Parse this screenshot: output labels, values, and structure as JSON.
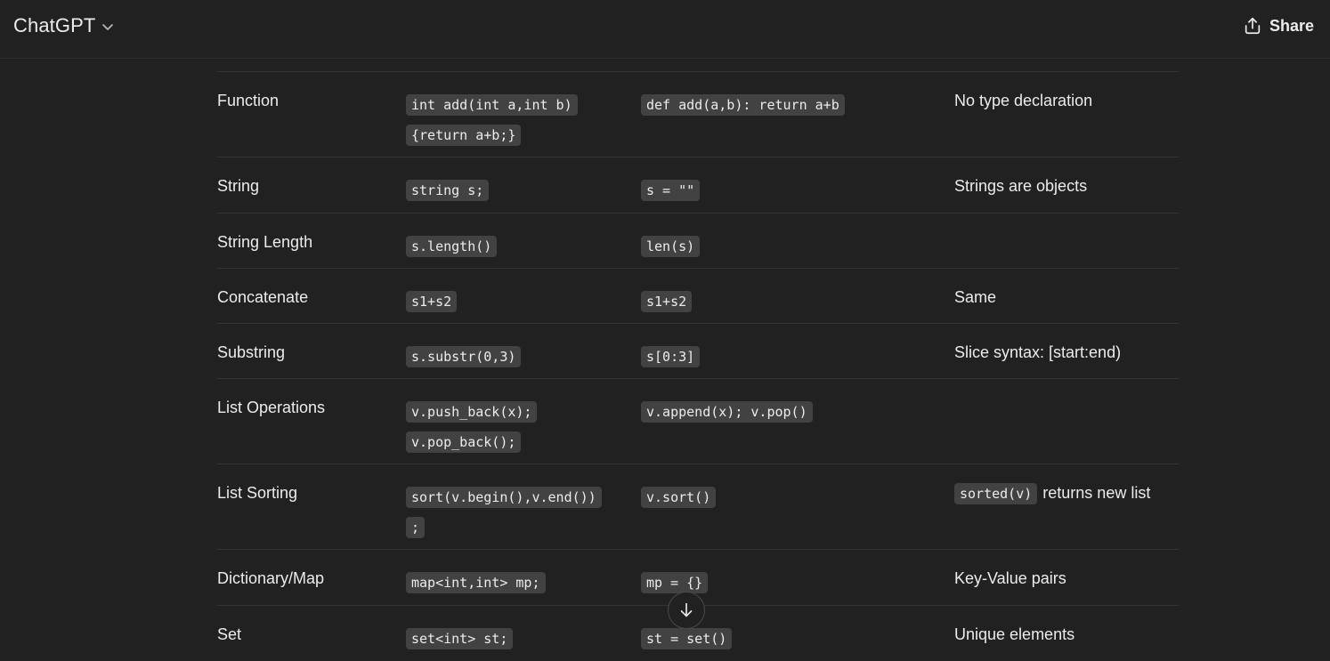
{
  "header": {
    "title": "ChatGPT",
    "share_label": "Share"
  },
  "rows": [
    {
      "feature": "Function",
      "cpp": "int add(int a,int b)",
      "cpp2": "{return a+b;}",
      "python": "def add(a,b): return a+b",
      "note": "No type declaration",
      "note_code": ""
    },
    {
      "feature": "String",
      "cpp": "string s;",
      "cpp2": "",
      "python": "s = \"\"",
      "note": "Strings are objects",
      "note_code": ""
    },
    {
      "feature": "String Length",
      "cpp": "s.length()",
      "cpp2": "",
      "python": "len(s)",
      "note": "",
      "note_code": ""
    },
    {
      "feature": "Concatenate",
      "cpp": "s1+s2",
      "cpp2": "",
      "python": "s1+s2",
      "note": "Same",
      "note_code": ""
    },
    {
      "feature": "Substring",
      "cpp": "s.substr(0,3)",
      "cpp2": "",
      "python": "s[0:3]",
      "note": "Slice syntax: [start:end)",
      "note_code": ""
    },
    {
      "feature": "List Operations",
      "cpp": "v.push_back(x);",
      "cpp2": "v.pop_back();",
      "python": "v.append(x); v.pop()",
      "note": "",
      "note_code": ""
    },
    {
      "feature": "List Sorting",
      "cpp": "sort(v.begin(),v.end())",
      "cpp2": ";",
      "python": "v.sort()",
      "note": "returns new list",
      "note_code": "sorted(v)"
    },
    {
      "feature": "Dictionary/Map",
      "cpp": "map<int,int> mp;",
      "cpp2": "",
      "python": "mp = {}",
      "note": "Key-Value pairs",
      "note_code": ""
    },
    {
      "feature": "Set",
      "cpp": "set<int> st;",
      "cpp2": "",
      "python": "st = set()",
      "note": "Unique elements",
      "note_code": ""
    }
  ],
  "icons": {
    "chevron": "chevron-down-icon",
    "share": "share-icon",
    "scroll": "arrow-down-icon"
  }
}
